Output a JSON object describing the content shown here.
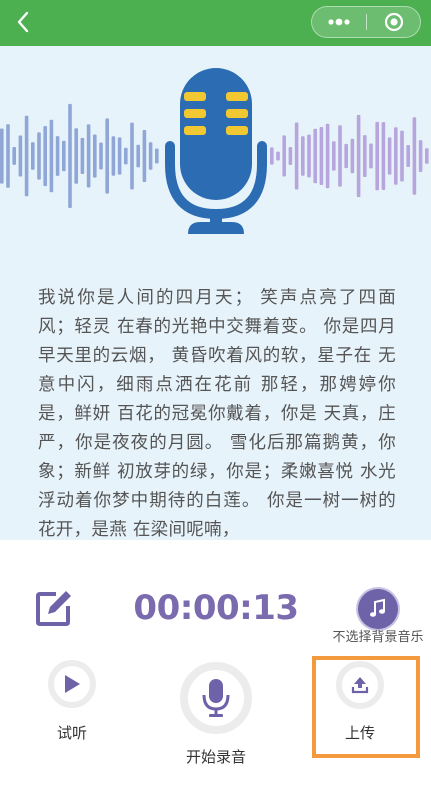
{
  "header": {
    "back_icon": "chevron-left-icon",
    "more_icon": "more-dots-icon",
    "close_icon": "target-close-icon",
    "bar_color": "#4CAF50"
  },
  "hero": {
    "icon": "microphone-icon",
    "wave_colors": [
      "#8FA6D6",
      "#B7A5DD"
    ],
    "mic_color": "#2B6CB3",
    "mic_grille_color": "#F1C832"
  },
  "lyrics": {
    "text": "我说你是人间的四月天； 笑声点亮了四面风；轻灵 在春的光艳中交舞着变。 你是四月早天里的云烟， 黄昏吹着风的软，星子在 无意中闪，细雨点洒在花前 那轻，那娉婷你是，鲜妍 百花的冠冕你戴着，你是 天真，庄严，你是夜夜的月圆。 雪化后那篇鹅黄，你象；新鲜 初放芽的绿，你是；柔嫩喜悦 水光浮动着你梦中期待的白莲。 你是一树一树的花开，是燕 在梁间呢喃，"
  },
  "controls": {
    "timer": "00:00:13",
    "music_label": "不选择背景音乐",
    "listen_label": "试听",
    "record_label": "开始录音",
    "upload_label": "上传",
    "edit_icon": "edit-icon",
    "music_icon": "music-note-icon",
    "play_icon": "play-icon",
    "mic_icon": "microphone-icon",
    "upload_icon": "upload-icon",
    "accent_color": "#7A6AAE",
    "highlight_color": "#F39A3E"
  }
}
